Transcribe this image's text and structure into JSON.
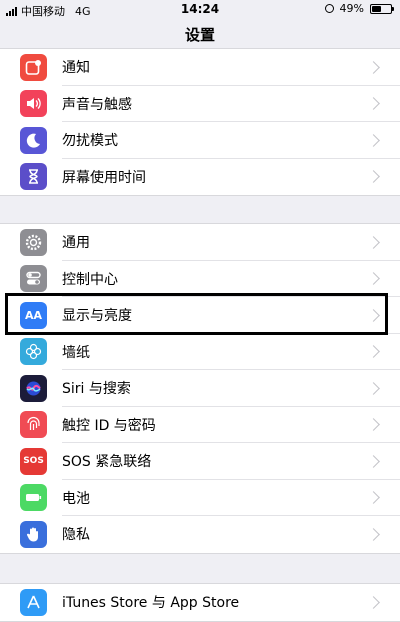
{
  "status_bar": {
    "carrier": "中国移动",
    "network": "4G",
    "time": "14:24",
    "battery": "49%",
    "battery_level": 0.49
  },
  "nav": {
    "title": "设置"
  },
  "group1": [
    {
      "label": "通知",
      "icon": "notifications-icon",
      "color": "#f04b3f"
    },
    {
      "label": "声音与触感",
      "icon": "sound-icon",
      "color": "#f2425a"
    },
    {
      "label": "勿扰模式",
      "icon": "moon-icon",
      "color": "#5856d6"
    },
    {
      "label": "屏幕使用时间",
      "icon": "hourglass-icon",
      "color": "#5b4ec9"
    }
  ],
  "group2": [
    {
      "label": "通用",
      "icon": "gear-icon",
      "color": "#8e8e93"
    },
    {
      "label": "控制中心",
      "icon": "toggle-icon",
      "color": "#8e8e93"
    },
    {
      "label": "显示与亮度",
      "icon": "display-icon",
      "color": "#2f7cf6",
      "glyph": "AA"
    },
    {
      "label": "墙纸",
      "icon": "wallpaper-icon",
      "color": "#34aadc"
    },
    {
      "label": "Siri 与搜索",
      "icon": "siri-icon",
      "color": "#1c1c3a"
    },
    {
      "label": "触控 ID 与密码",
      "icon": "fingerprint-icon",
      "color": "#f04b54"
    },
    {
      "label": "SOS 紧急联络",
      "icon": "sos-icon",
      "color": "#e53935",
      "glyph": "SOS"
    },
    {
      "label": "电池",
      "icon": "battery-icon",
      "color": "#4cd964"
    },
    {
      "label": "隐私",
      "icon": "hand-icon",
      "color": "#3a6fdc"
    }
  ],
  "group3": [
    {
      "label": "iTunes Store 与 App Store",
      "icon": "app-store-icon",
      "color": "#2f9bf6"
    }
  ]
}
